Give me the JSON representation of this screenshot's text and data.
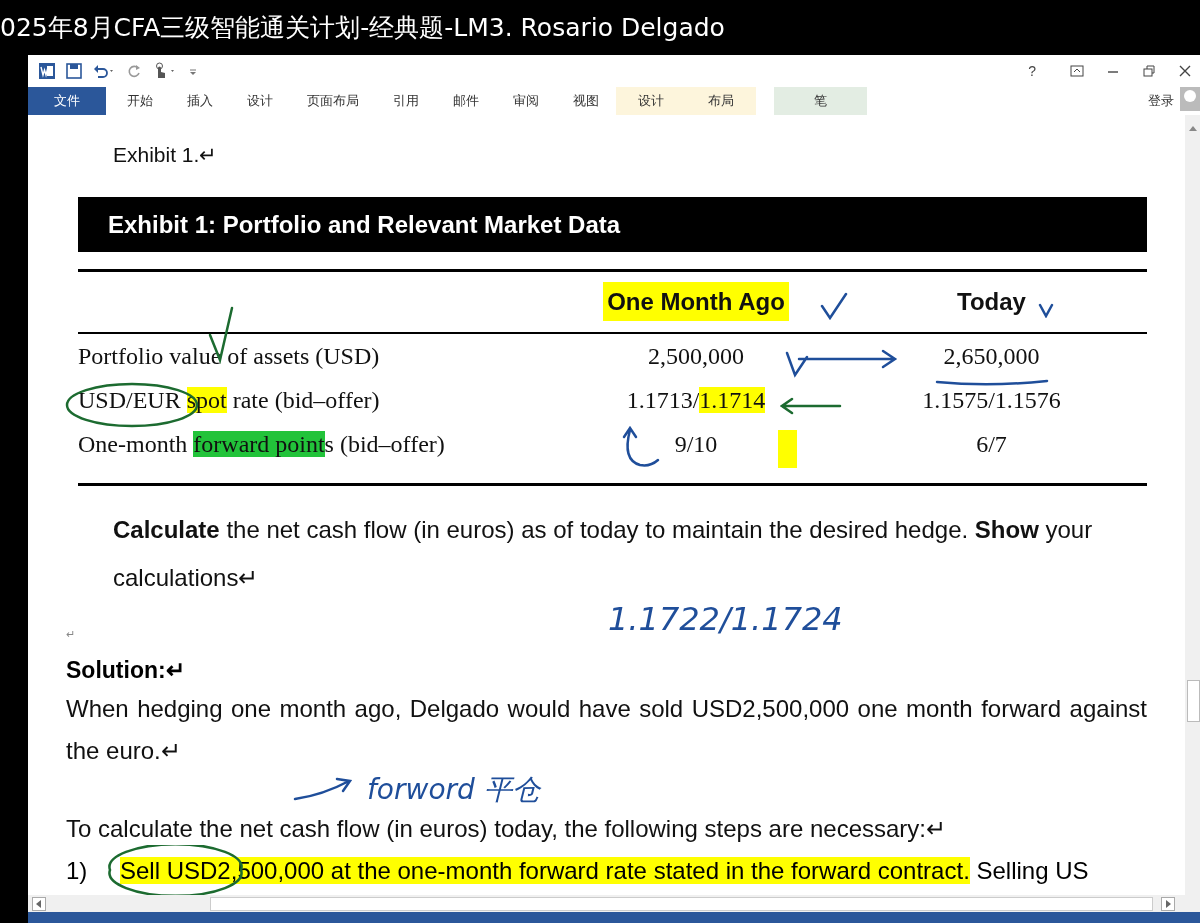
{
  "title": "025年8月CFA三级智能通关计划-经典题-LM3. Rosario Delgado",
  "window_help": "?",
  "ribbon": {
    "tabs": [
      {
        "label": "文件",
        "kind": "file"
      },
      {
        "label": "开始",
        "kind": "normal"
      },
      {
        "label": "插入",
        "kind": "normal"
      },
      {
        "label": "设计",
        "kind": "normal"
      },
      {
        "label": "页面布局",
        "kind": "normal"
      },
      {
        "label": "引用",
        "kind": "normal"
      },
      {
        "label": "邮件",
        "kind": "normal"
      },
      {
        "label": "审阅",
        "kind": "normal"
      },
      {
        "label": "视图",
        "kind": "normal"
      },
      {
        "label": "设计",
        "kind": "table"
      },
      {
        "label": "布局",
        "kind": "table"
      },
      {
        "label": "笔",
        "kind": "pen"
      }
    ],
    "signin": "登录"
  },
  "document": {
    "caption": "Exhibit 1.↵",
    "exhibit": {
      "title": "Exhibit 1: Portfolio and Relevant Market Data",
      "columns": [
        {
          "label": "One Month Ago",
          "color": "#ffff00"
        },
        {
          "label": "Today"
        }
      ],
      "rows": [
        {
          "label": [
            {
              "text": "Portfolio value of assets (USD)"
            }
          ],
          "values": [
            [
              {
                "text": "2,500,000"
              }
            ],
            [
              {
                "text": "2,650,000"
              }
            ]
          ]
        },
        {
          "label": [
            {
              "text": "USD/EUR "
            },
            {
              "text": "spot",
              "color": "#ffff00"
            },
            {
              "text": " rate (bid–offer)"
            }
          ],
          "values": [
            [
              {
                "text": "1.1713/"
              },
              {
                "text": "1.1714",
                "color": "#ffff00"
              }
            ],
            [
              {
                "text": "1.1575/1.1576"
              }
            ]
          ]
        },
        {
          "label": [
            {
              "text": "One-month "
            },
            {
              "text": "forward point",
              "color": "#22c33a"
            },
            {
              "text": "s (bid–offer)"
            }
          ],
          "values": [
            [
              {
                "text": "9/10"
              }
            ],
            [
              {
                "text": "6/7"
              }
            ]
          ]
        }
      ]
    },
    "question": "**Calculate** the net cash flow (in euros) as of today to maintain the desired hedge. **Show** your calculations↵",
    "handwritten_notes": [
      "1.1722/1.1724",
      "forword 平仓"
    ],
    "empty_mark": "↵",
    "solution_heading": "Solution:↵",
    "paragraphs": [
      "When hedging one month ago, Delgado would have sold USD2,500,000 one month forward against the euro.↵",
      "To calculate the net cash flow (in euros) today, the following steps are necessary:↵"
    ],
    "steps": [
      {
        "number": "1)",
        "parts": [
          {
            "text": "Sell USD2,500,000 at the one-month forward rate stated in the forward contract.",
            "color": "#ffff00"
          },
          {
            "text": " Selling US"
          }
        ]
      }
    ]
  }
}
